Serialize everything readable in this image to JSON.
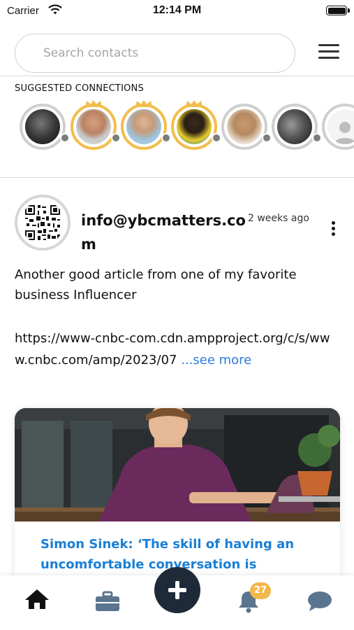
{
  "status_bar": {
    "carrier": "Carrier",
    "time": "12:14 PM"
  },
  "search": {
    "placeholder": "Search contacts"
  },
  "suggested": {
    "title": "SUGGESTED CONNECTIONS",
    "avatars": [
      {
        "ring": "gray",
        "crown": false
      },
      {
        "ring": "gold",
        "crown": true
      },
      {
        "ring": "gold",
        "crown": true
      },
      {
        "ring": "gold",
        "crown": true
      },
      {
        "ring": "gray",
        "crown": false
      },
      {
        "ring": "gray",
        "crown": false
      },
      {
        "ring": "gray",
        "crown": false,
        "placeholder": true
      }
    ]
  },
  "post": {
    "author": "info@ybcmatters.com",
    "time": "2 weeks ago",
    "text": "Another good article from one of my favorite business Influencer",
    "link": "https://www-cnbc-com.cdn.ampproject.org/c/s/www.cnbc.com/amp/2023/07",
    "see_more": "...see more",
    "card": {
      "title": "Simon Sinek: ‘The skill of having an uncomfortable conversation is"
    }
  },
  "tabbar": {
    "notifications_count": "27",
    "items": [
      "home-tab",
      "jobs-tab",
      "add-button",
      "notifications-tab",
      "messages-tab"
    ]
  },
  "colors": {
    "accent": "#1a7fd6",
    "gold": "#f2bd4c",
    "fab": "#1f2a38",
    "link": "#2f7be0"
  }
}
